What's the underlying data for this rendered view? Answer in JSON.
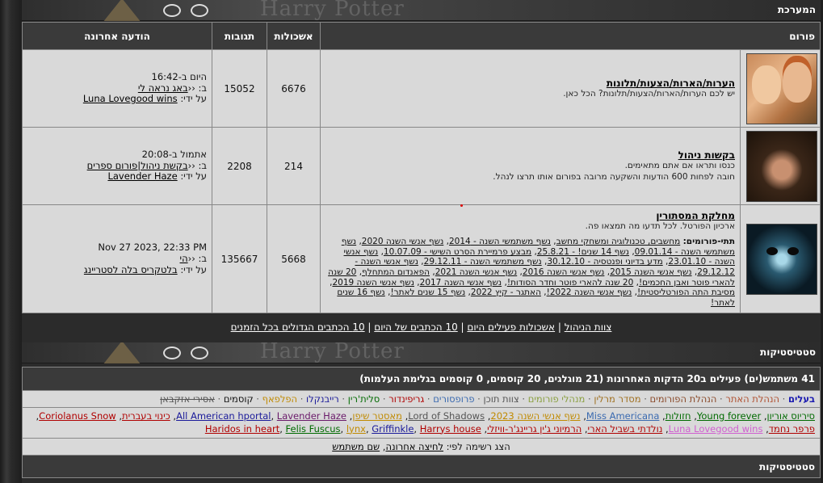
{
  "header": {
    "title": "המערכת",
    "banner_text": "Harry Potter"
  },
  "table": {
    "headers": {
      "forum": "פורום",
      "topics": "אשכולות",
      "posts": "תגובות",
      "last": "הודעה אחרונה"
    },
    "rows": [
      {
        "title": "הערות/הארות/הצעות/תלונות",
        "desc": "יש לכם הערות/הארות/הצעות/תלונות? הכל כאן.",
        "topics": "6676",
        "posts": "15052",
        "last_when": "היום ב-16:42",
        "last_prefix": "ב: ‹‹",
        "last_topic": "באג נראה לי",
        "last_by_label": "על ידי:",
        "last_by": "Luna Lovegood wins"
      },
      {
        "title": "בקשות ניהול",
        "desc1": "כנסו ותראו אם אתם מתאימים.",
        "desc2": "חובה לפחות 600 הודעות והשקעה מרובה בפורום אותו תרצו לנהל.",
        "topics": "214",
        "posts": "2208",
        "last_when": "אתמול ב-20:08",
        "last_prefix": "ב: ‹‹",
        "last_topic": "בקשת ניהול|פורום ספרים",
        "last_by_label": "על ידי:",
        "last_by": "Lavender Haze"
      },
      {
        "title": "מחלקת המסתורין",
        "desc": "ארכיון הפורטל. לכל תדעו מה תמצאו פה.",
        "subforums_label": "תתי-פורומים:",
        "subforums": [
          "מחשבים, טכנולוגיה ומשחקי מחשב",
          "נשף משתמשי השנה - 2014",
          "נשף אנשי השנה 2020",
          "נשף משתמשי השנה - 09.01.14",
          "נשף 14 שנים! - 25.8.21",
          "מבצע פרמיירת הסרט השישי - 10.07.09",
          "נשף אנשי השנה - 23.01.10",
          "מדע בדיוני ופנטסיה - 30.12.10",
          "נשף משתמשי השנה - 29.12.11",
          "נשף אנשי השנה - 29.12.12",
          "נשף אנשי השנה 2015",
          "נשף אנשי השנה 2016",
          "נשף אנשי השנה 2021",
          "הפאנדום המתחלף",
          "20 שנה להארי פוטר ואבן החכמים!",
          "20 שנה להארי פוטר וחדר הסודות!",
          "נשף אנשי השנה 2017",
          "נשף אנשי השנה 2019",
          "מסיבת התה הפורטליסטית!",
          "נשף אנשי השנה 2022!",
          "האתגר - קיץ 2022",
          "נשף 15 שנים לאתר!",
          "נשף 16 שנים לאתר!"
        ],
        "topics": "5668",
        "posts": "135667",
        "last_when": "Nov 27 2023, 22:33 PM",
        "last_prefix": "ב: ‹‹",
        "last_topic": "הי",
        "last_by_label": "על ידי:",
        "last_by": "בלטקריס בלה לסטריינג"
      }
    ]
  },
  "links": [
    "צוות הניהול",
    "אשכולות פעילים היום",
    "10 הכתבים של היום",
    "10 הכתבים הגדולים בכל הזמנים"
  ],
  "stats": {
    "title": "סטטיסטיקות",
    "online_head": "41 משתמש(ים) פעילים ב20 הדקות האחרונות (21 מוגלגים, 20 קוסמים, 0 קוסמים בגלימת העלמות)",
    "groups": [
      {
        "name": "בעלים",
        "color": "#1a1ab0",
        "bold": true
      },
      {
        "name": "הנהלת האתר",
        "color": "#b05030"
      },
      {
        "name": "הנהלת הפורומים",
        "color": "#8a4a2a"
      },
      {
        "name": "מסדר מרלין",
        "color": "#a07020"
      },
      {
        "name": "מנהלי פורומים",
        "color": "#8aa040"
      },
      {
        "name": "צוות תוכן",
        "color": "#555555"
      },
      {
        "name": "פרופסורים",
        "color": "#3a6ab0"
      },
      {
        "name": "גריפינדור",
        "color": "#b00000"
      },
      {
        "name": "סלית'רין",
        "color": "#006a00"
      },
      {
        "name": "רייבנקלו",
        "color": "#1a1a9a"
      },
      {
        "name": "הפלפאף",
        "color": "#c08a00"
      },
      {
        "name": "קוסמים",
        "color": "#111111"
      },
      {
        "name": "אסירי אזקבאן",
        "color": "#555555",
        "strike": true
      }
    ],
    "users": [
      {
        "name": "סיריוס אוריון",
        "color": "#006a00"
      },
      {
        "name": "Young forever",
        "color": "#006a00"
      },
      {
        "name": "חזולות",
        "color": "#006a00"
      },
      {
        "name": "Miss Americana",
        "color": "#3a6ab0"
      },
      {
        "name": "נשף אנשי השנה 2023",
        "color": "#c08a00"
      },
      {
        "name": "Lord of Shadows",
        "color": "#555555"
      },
      {
        "name": "מאסטר שיפן",
        "color": "#c08a00"
      },
      {
        "name": "All American hportal",
        "color": "#1a1a9a"
      },
      {
        "name": "Lavender Haze",
        "color": "#6a1a6a"
      },
      {
        "name": "כינוי בעברית",
        "color": "#b00000"
      },
      {
        "name": "Coriolanus Snow",
        "color": "#b00000"
      },
      {
        "name": "פרפר נחמד",
        "color": "#b00000"
      },
      {
        "name": "Luna Lovegood wins",
        "color": "#d060d0"
      },
      {
        "name": "נולדתי בשביל הארי",
        "color": "#b00000"
      },
      {
        "name": "הרמיוני ג'ין גריינג'ר-וויזלי",
        "color": "#b00000"
      },
      {
        "name": "Haridos in heart",
        "color": "#b00000"
      },
      {
        "name": "Felis Fuscus",
        "color": "#006a00"
      },
      {
        "name": "lynx",
        "color": "#c08a00"
      },
      {
        "name": "Griffinkle",
        "color": "#1a1a9a"
      },
      {
        "name": "Harrys house",
        "color": "#b00000"
      }
    ],
    "sort_label": "הצג רשימה לפי:",
    "sort_options": [
      "לחיצה אחרונה",
      "שם משתמש"
    ],
    "stats2_title": "סטטיסטיקות"
  }
}
